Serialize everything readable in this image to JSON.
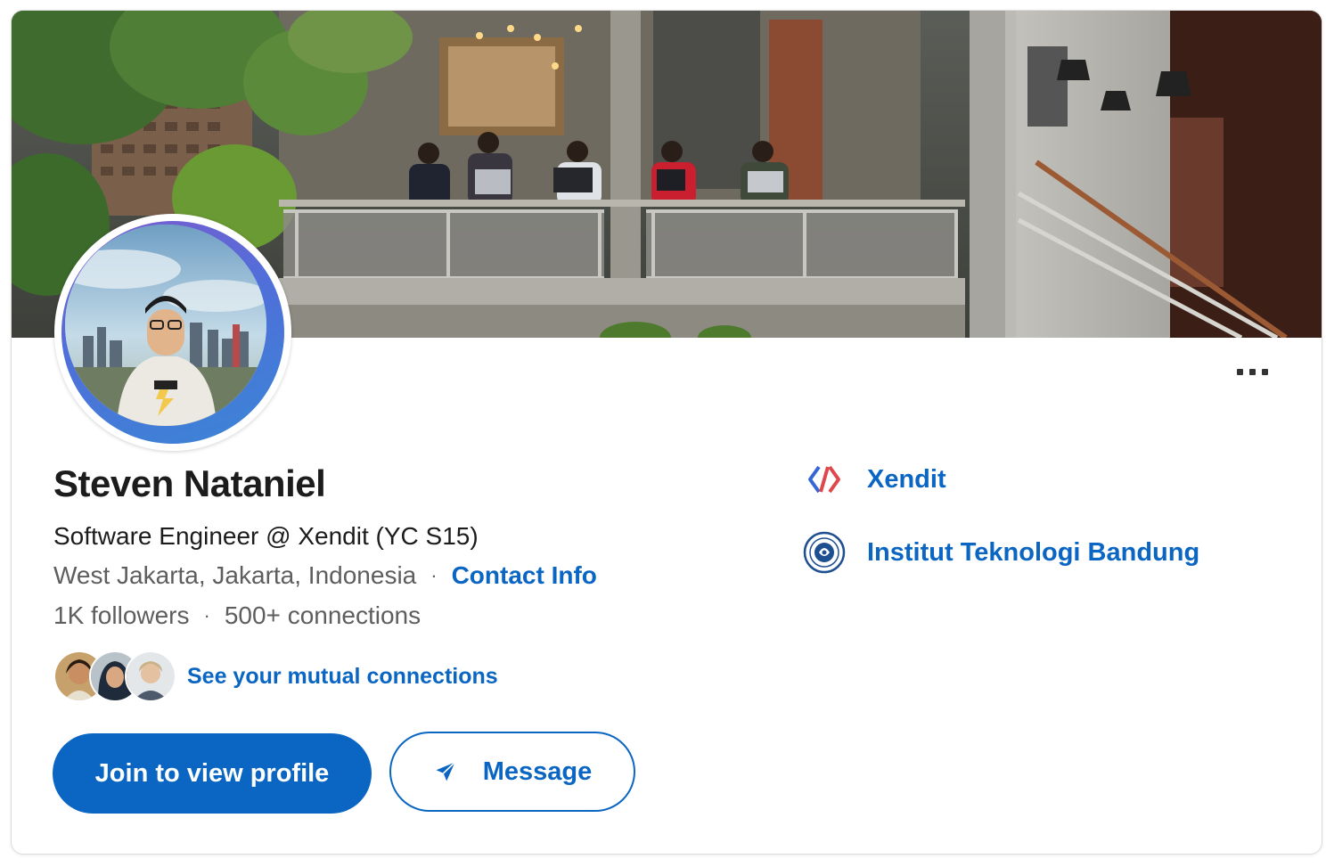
{
  "profile": {
    "name": "Steven Nataniel",
    "headline": "Software Engineer @ Xendit (YC S15)",
    "location": "West Jakarta, Jakarta, Indonesia",
    "separator": "·",
    "contact_info_label": "Contact Info",
    "followers": "1K followers",
    "connections": "500+ connections",
    "mutual_connections_label": "See your mutual connections"
  },
  "actions": {
    "join_label": "Join to view profile",
    "message_label": "Message"
  },
  "organizations": [
    {
      "name": "Xendit",
      "icon": "xendit-logo-icon"
    },
    {
      "name": "Institut Teknologi Bandung",
      "icon": "itb-seal-icon"
    }
  ],
  "colors": {
    "brand_blue": "#0a66c2",
    "text_primary": "#1c1c1c",
    "text_secondary": "#5e5e5e"
  }
}
